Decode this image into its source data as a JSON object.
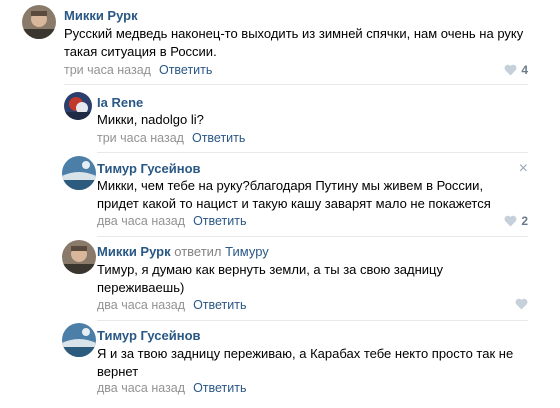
{
  "comments": [
    {
      "author": "Микки Рурк",
      "text": "Русский медведь наконец-то выходить из зимней спячки, нам очень на руку такая ситуация в России.",
      "time": "три часа назад",
      "reply_label": "Ответить",
      "likes": "4"
    },
    {
      "author": "Ia Rene",
      "text": "Микки, nadolgo li?",
      "time": "три часа назад",
      "reply_label": "Ответить"
    },
    {
      "author": "Тимур Гусейнов",
      "text": "Микки, чем тебе на руку?благодаря Путину мы живем в России, придет какой то нацист и такую кашу заварят мало не покажется",
      "time": "два часа назад",
      "reply_label": "Ответить",
      "likes": "2",
      "close_glyph": "×"
    },
    {
      "author": "Микки Рурк",
      "replied_verb": "ответил",
      "replied_to": "Тимуру",
      "text": "Тимур, я думаю как вернуть земли, а ты за свою задницу переживаешь)",
      "time": "два часа назад",
      "reply_label": "Ответить"
    },
    {
      "author": "Тимур Гусейнов",
      "text": "Я и за твою задницу переживаю, а Карабах тебе некто просто так не вернет",
      "time": "два часа назад",
      "reply_label": "Ответить"
    }
  ],
  "colors": {
    "link": "#2a5885",
    "meta": "#939393",
    "separator": "#e7e8ec",
    "like_icon": "#c5d0db"
  },
  "icons": [
    "heart-icon",
    "close-icon",
    "avatar"
  ]
}
